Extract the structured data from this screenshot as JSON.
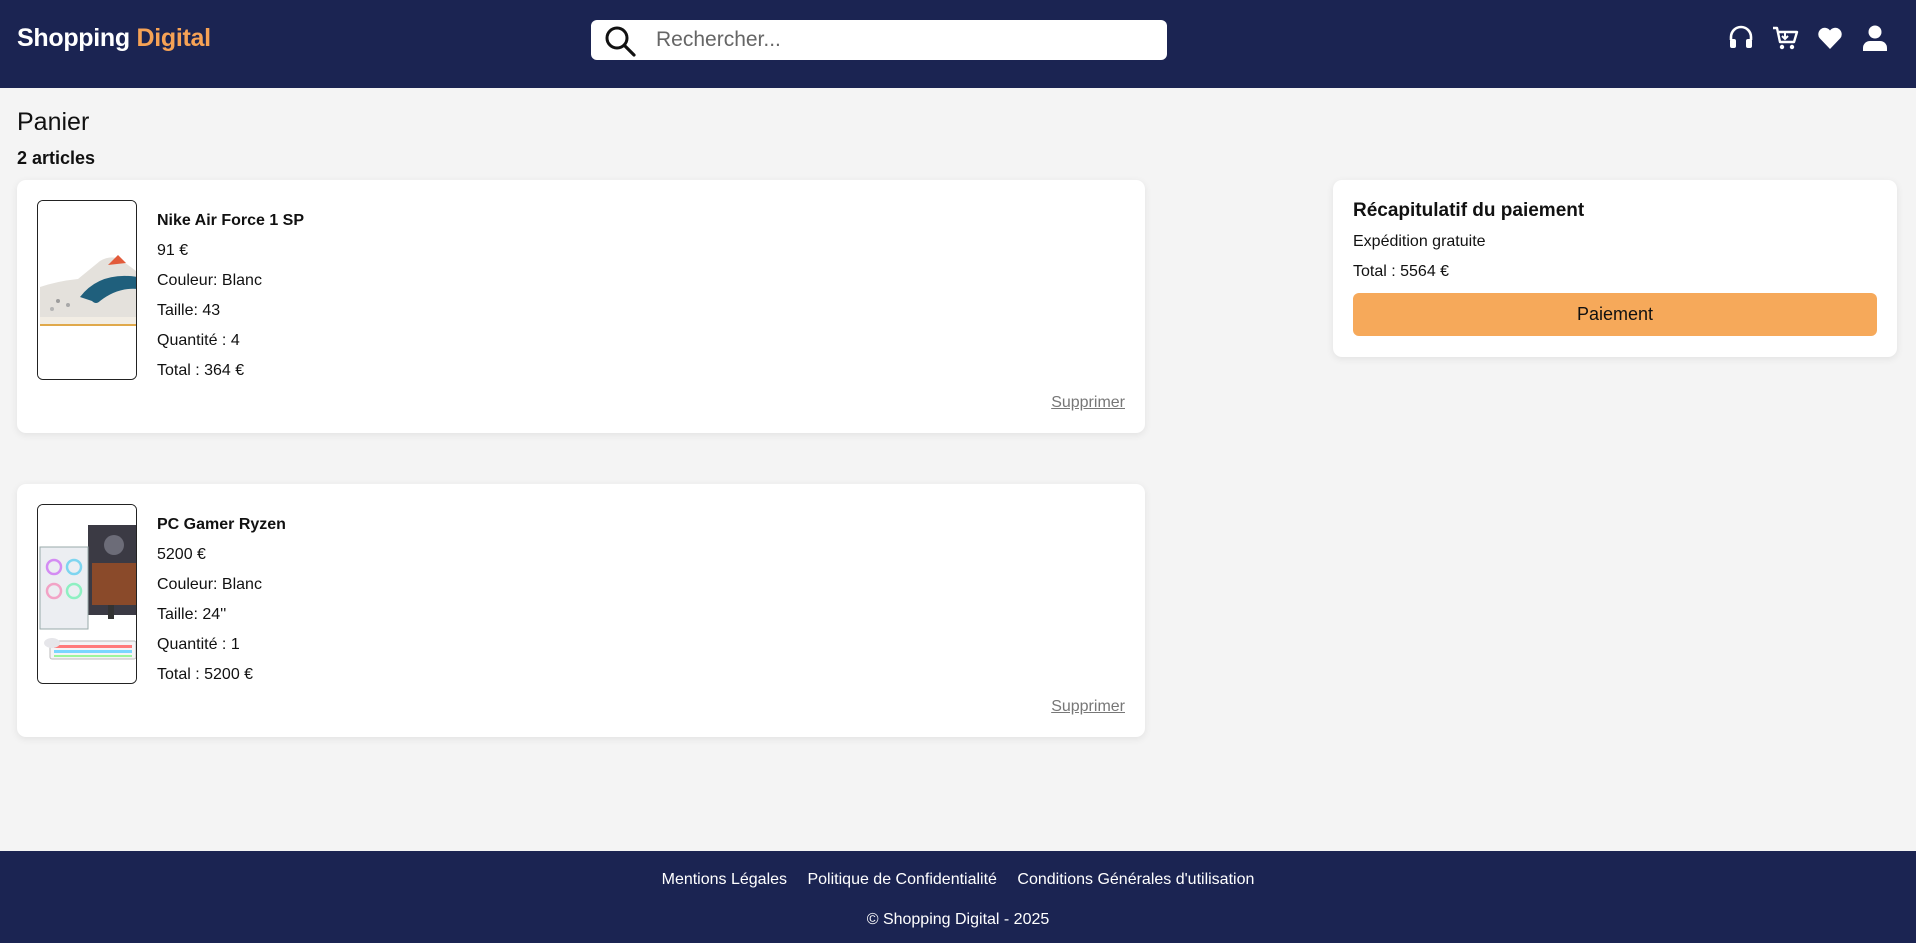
{
  "header": {
    "brand_part1": "Shopping",
    "brand_part2": "Digital",
    "search_placeholder": "Rechercher...",
    "icons": [
      "headset-icon",
      "cart-icon",
      "heart-icon",
      "user-icon"
    ]
  },
  "cart": {
    "title": "Panier",
    "count_label": "2 articles",
    "items": [
      {
        "name": "Nike Air Force 1 SP",
        "price": "91 €",
        "color": "Couleur: Blanc",
        "size": "Taille: 43",
        "quantity": "Quantité : 4",
        "total": "Total : 364 €",
        "remove_label": "Supprimer",
        "image": "sneaker-image"
      },
      {
        "name": "PC Gamer Ryzen",
        "price": "5200 €",
        "color": "Couleur: Blanc",
        "size": "Taille: 24''",
        "quantity": "Quantité : 1",
        "total": "Total : 5200 €",
        "remove_label": "Supprimer",
        "image": "gaming-pc-image"
      }
    ]
  },
  "summary": {
    "title": "Récapitulatif du paiement",
    "shipping": "Expédition gratuite",
    "total": "Total : 5564 €",
    "pay_button": "Paiement"
  },
  "footer": {
    "links": [
      "Mentions Légales",
      "Politique de Confidentialité",
      "Conditions Générales d'utilisation"
    ],
    "copyright": "© Shopping Digital - 2025"
  },
  "colors": {
    "navy": "#1b2452",
    "accent": "#f6a255",
    "button": "#f6a95a",
    "background": "#f4f4f4"
  }
}
